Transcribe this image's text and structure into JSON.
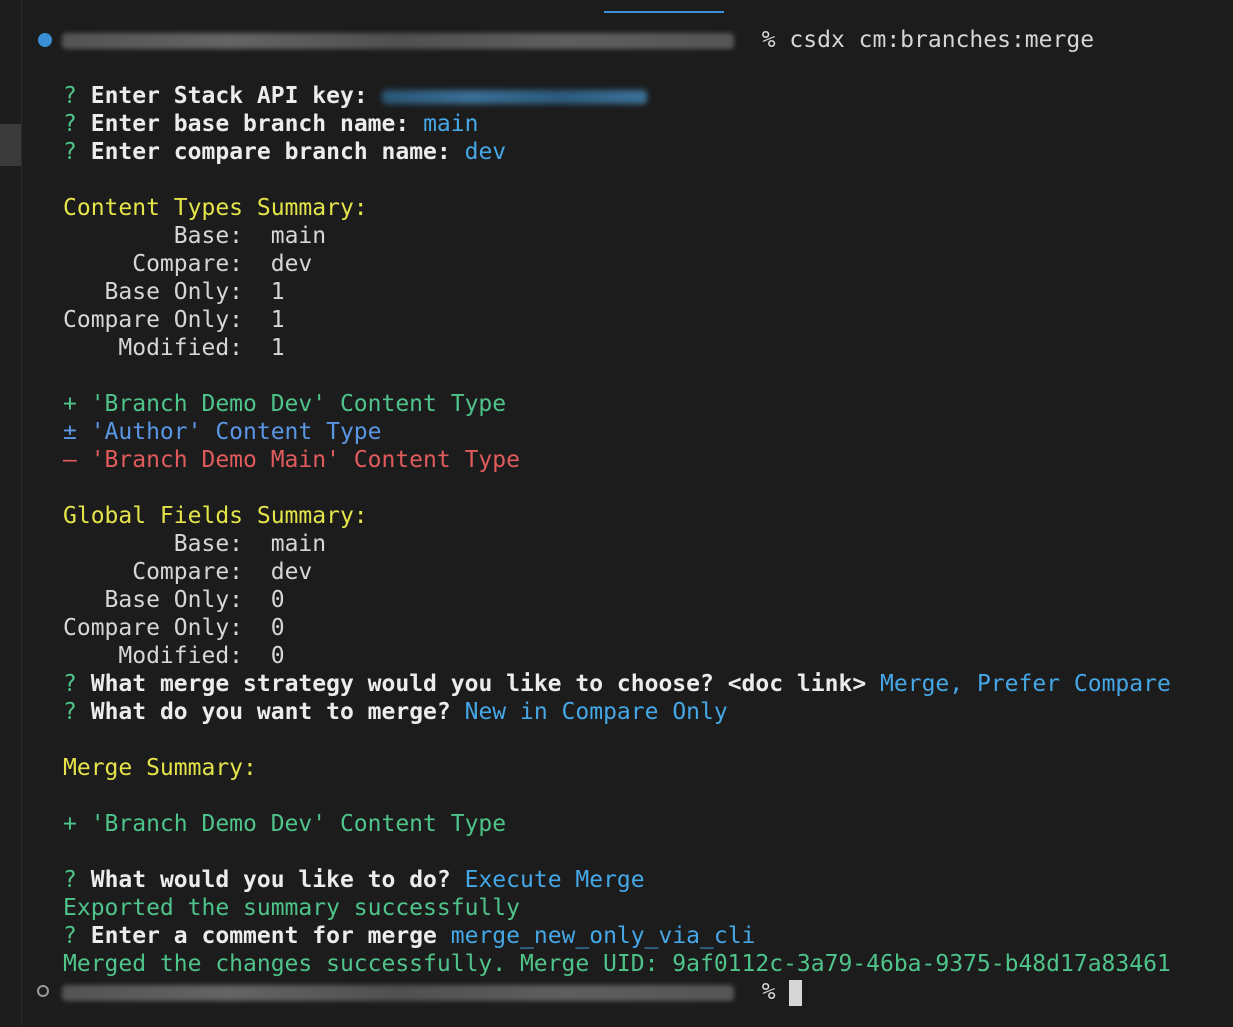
{
  "prompt": {
    "command_line": "% csdx cm:branches:merge",
    "end_symbol": "%"
  },
  "questions": {
    "mark": "?",
    "api_key": "Enter Stack API key:",
    "base_branch": "Enter base branch name:",
    "base_branch_answer": "main",
    "compare_branch": "Enter compare branch name:",
    "compare_branch_answer": "dev",
    "strategy": "What merge strategy would you like to choose? <doc link>",
    "strategy_answer": "Merge, Prefer Compare",
    "what_merge": "What do you want to merge?",
    "what_merge_answer": "New in Compare Only",
    "action": "What would you like to do?",
    "action_answer": "Execute Merge",
    "comment": "Enter a comment for merge",
    "comment_answer": "merge_new_only_via_cli"
  },
  "content_types": {
    "heading": "Content Types Summary:",
    "rows": [
      {
        "label": "        Base:  ",
        "value": "main"
      },
      {
        "label": "     Compare:  ",
        "value": "dev"
      },
      {
        "label": "   Base Only:  ",
        "value": "1"
      },
      {
        "label": "Compare Only:  ",
        "value": "1"
      },
      {
        "label": "    Modified:  ",
        "value": "1"
      }
    ],
    "changes": {
      "added": "+ 'Branch Demo Dev' Content Type",
      "modified": "± 'Author' Content Type",
      "removed": "– 'Branch Demo Main' Content Type"
    }
  },
  "global_fields": {
    "heading": "Global Fields Summary:",
    "rows": [
      {
        "label": "        Base:  ",
        "value": "main"
      },
      {
        "label": "     Compare:  ",
        "value": "dev"
      },
      {
        "label": "   Base Only:  ",
        "value": "0"
      },
      {
        "label": "Compare Only:  ",
        "value": "0"
      },
      {
        "label": "    Modified:  ",
        "value": "0"
      }
    ]
  },
  "merge_summary": {
    "heading": "Merge Summary:",
    "item": "+ 'Branch Demo Dev' Content Type"
  },
  "messages": {
    "exported": "Exported the summary successfully",
    "merged": "Merged the changes successfully. Merge UID: 9af0112c-3a79-46ba-9375-b48d17a83461"
  },
  "colors": {
    "background": "#1c1c1c",
    "question_mark": "#4fc48a",
    "answer": "#45a7e6",
    "heading": "#e4e44a",
    "added": "#4fc48a",
    "modified": "#5a96e3",
    "removed": "#e05b5b"
  }
}
